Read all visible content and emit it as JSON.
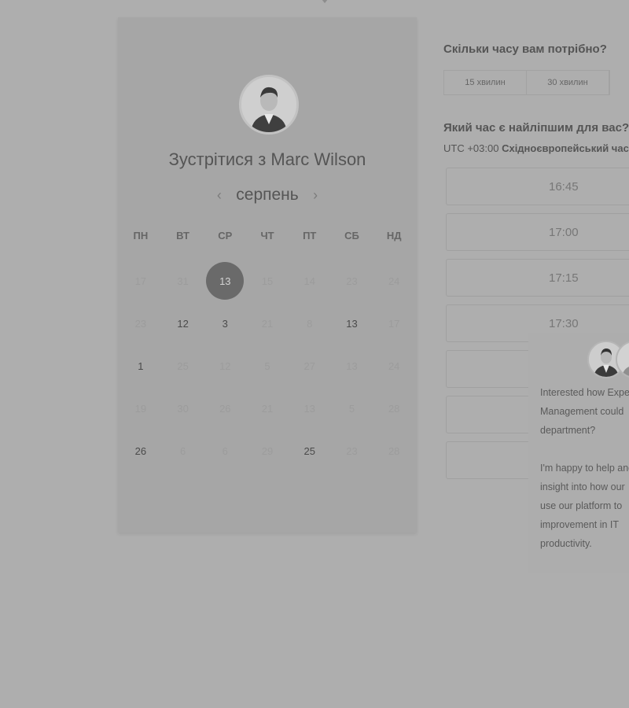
{
  "calendar": {
    "title": "Зустрітися з Marc Wilson",
    "month": "серпень",
    "prev_icon": "‹",
    "next_icon": "›",
    "weekdays": [
      "ПН",
      "ВТ",
      "СР",
      "ЧТ",
      "ПТ",
      "СБ",
      "НД"
    ],
    "weeks": [
      [
        {
          "t": "17",
          "s": "off"
        },
        {
          "t": "31",
          "s": "off"
        },
        {
          "t": "13",
          "s": "selected"
        },
        {
          "t": "15",
          "s": "off"
        },
        {
          "t": "14",
          "s": "off"
        },
        {
          "t": "23",
          "s": "off"
        },
        {
          "t": "24",
          "s": "off"
        }
      ],
      [
        {
          "t": "23",
          "s": "off"
        },
        {
          "t": "12",
          "s": "on"
        },
        {
          "t": "3",
          "s": "on"
        },
        {
          "t": "21",
          "s": "off"
        },
        {
          "t": "8",
          "s": "off"
        },
        {
          "t": "13",
          "s": "on"
        },
        {
          "t": "17",
          "s": "off"
        }
      ],
      [
        {
          "t": "1",
          "s": "on"
        },
        {
          "t": "25",
          "s": "off"
        },
        {
          "t": "12",
          "s": "off"
        },
        {
          "t": "5",
          "s": "off"
        },
        {
          "t": "27",
          "s": "off"
        },
        {
          "t": "13",
          "s": "off"
        },
        {
          "t": "24",
          "s": "off"
        }
      ],
      [
        {
          "t": "19",
          "s": "off"
        },
        {
          "t": "30",
          "s": "off"
        },
        {
          "t": "26",
          "s": "off"
        },
        {
          "t": "21",
          "s": "off"
        },
        {
          "t": "13",
          "s": "off"
        },
        {
          "t": "5",
          "s": "off"
        },
        {
          "t": "28",
          "s": "off"
        }
      ],
      [
        {
          "t": "26",
          "s": "on"
        },
        {
          "t": "6",
          "s": "off"
        },
        {
          "t": "6",
          "s": "off"
        },
        {
          "t": "29",
          "s": "off"
        },
        {
          "t": "25",
          "s": "on"
        },
        {
          "t": "23",
          "s": "off"
        },
        {
          "t": "28",
          "s": "off"
        }
      ]
    ]
  },
  "duration": {
    "question": "Скільки часу вам потрібно?",
    "options": [
      "15 хвилин",
      "30 хвилин"
    ]
  },
  "time": {
    "question": "Який час є найліпшим для вас?",
    "tz_prefix": "UTC +03:00",
    "tz_name": "Східноєвропейський час",
    "slots": [
      "16:45",
      "17:00",
      "17:15",
      "17:30"
    ]
  },
  "chat": {
    "message": "Interested how Expert Management could department?\n\nI'm happy to help and insight into how our use our platform to improvement in IT productivity."
  }
}
